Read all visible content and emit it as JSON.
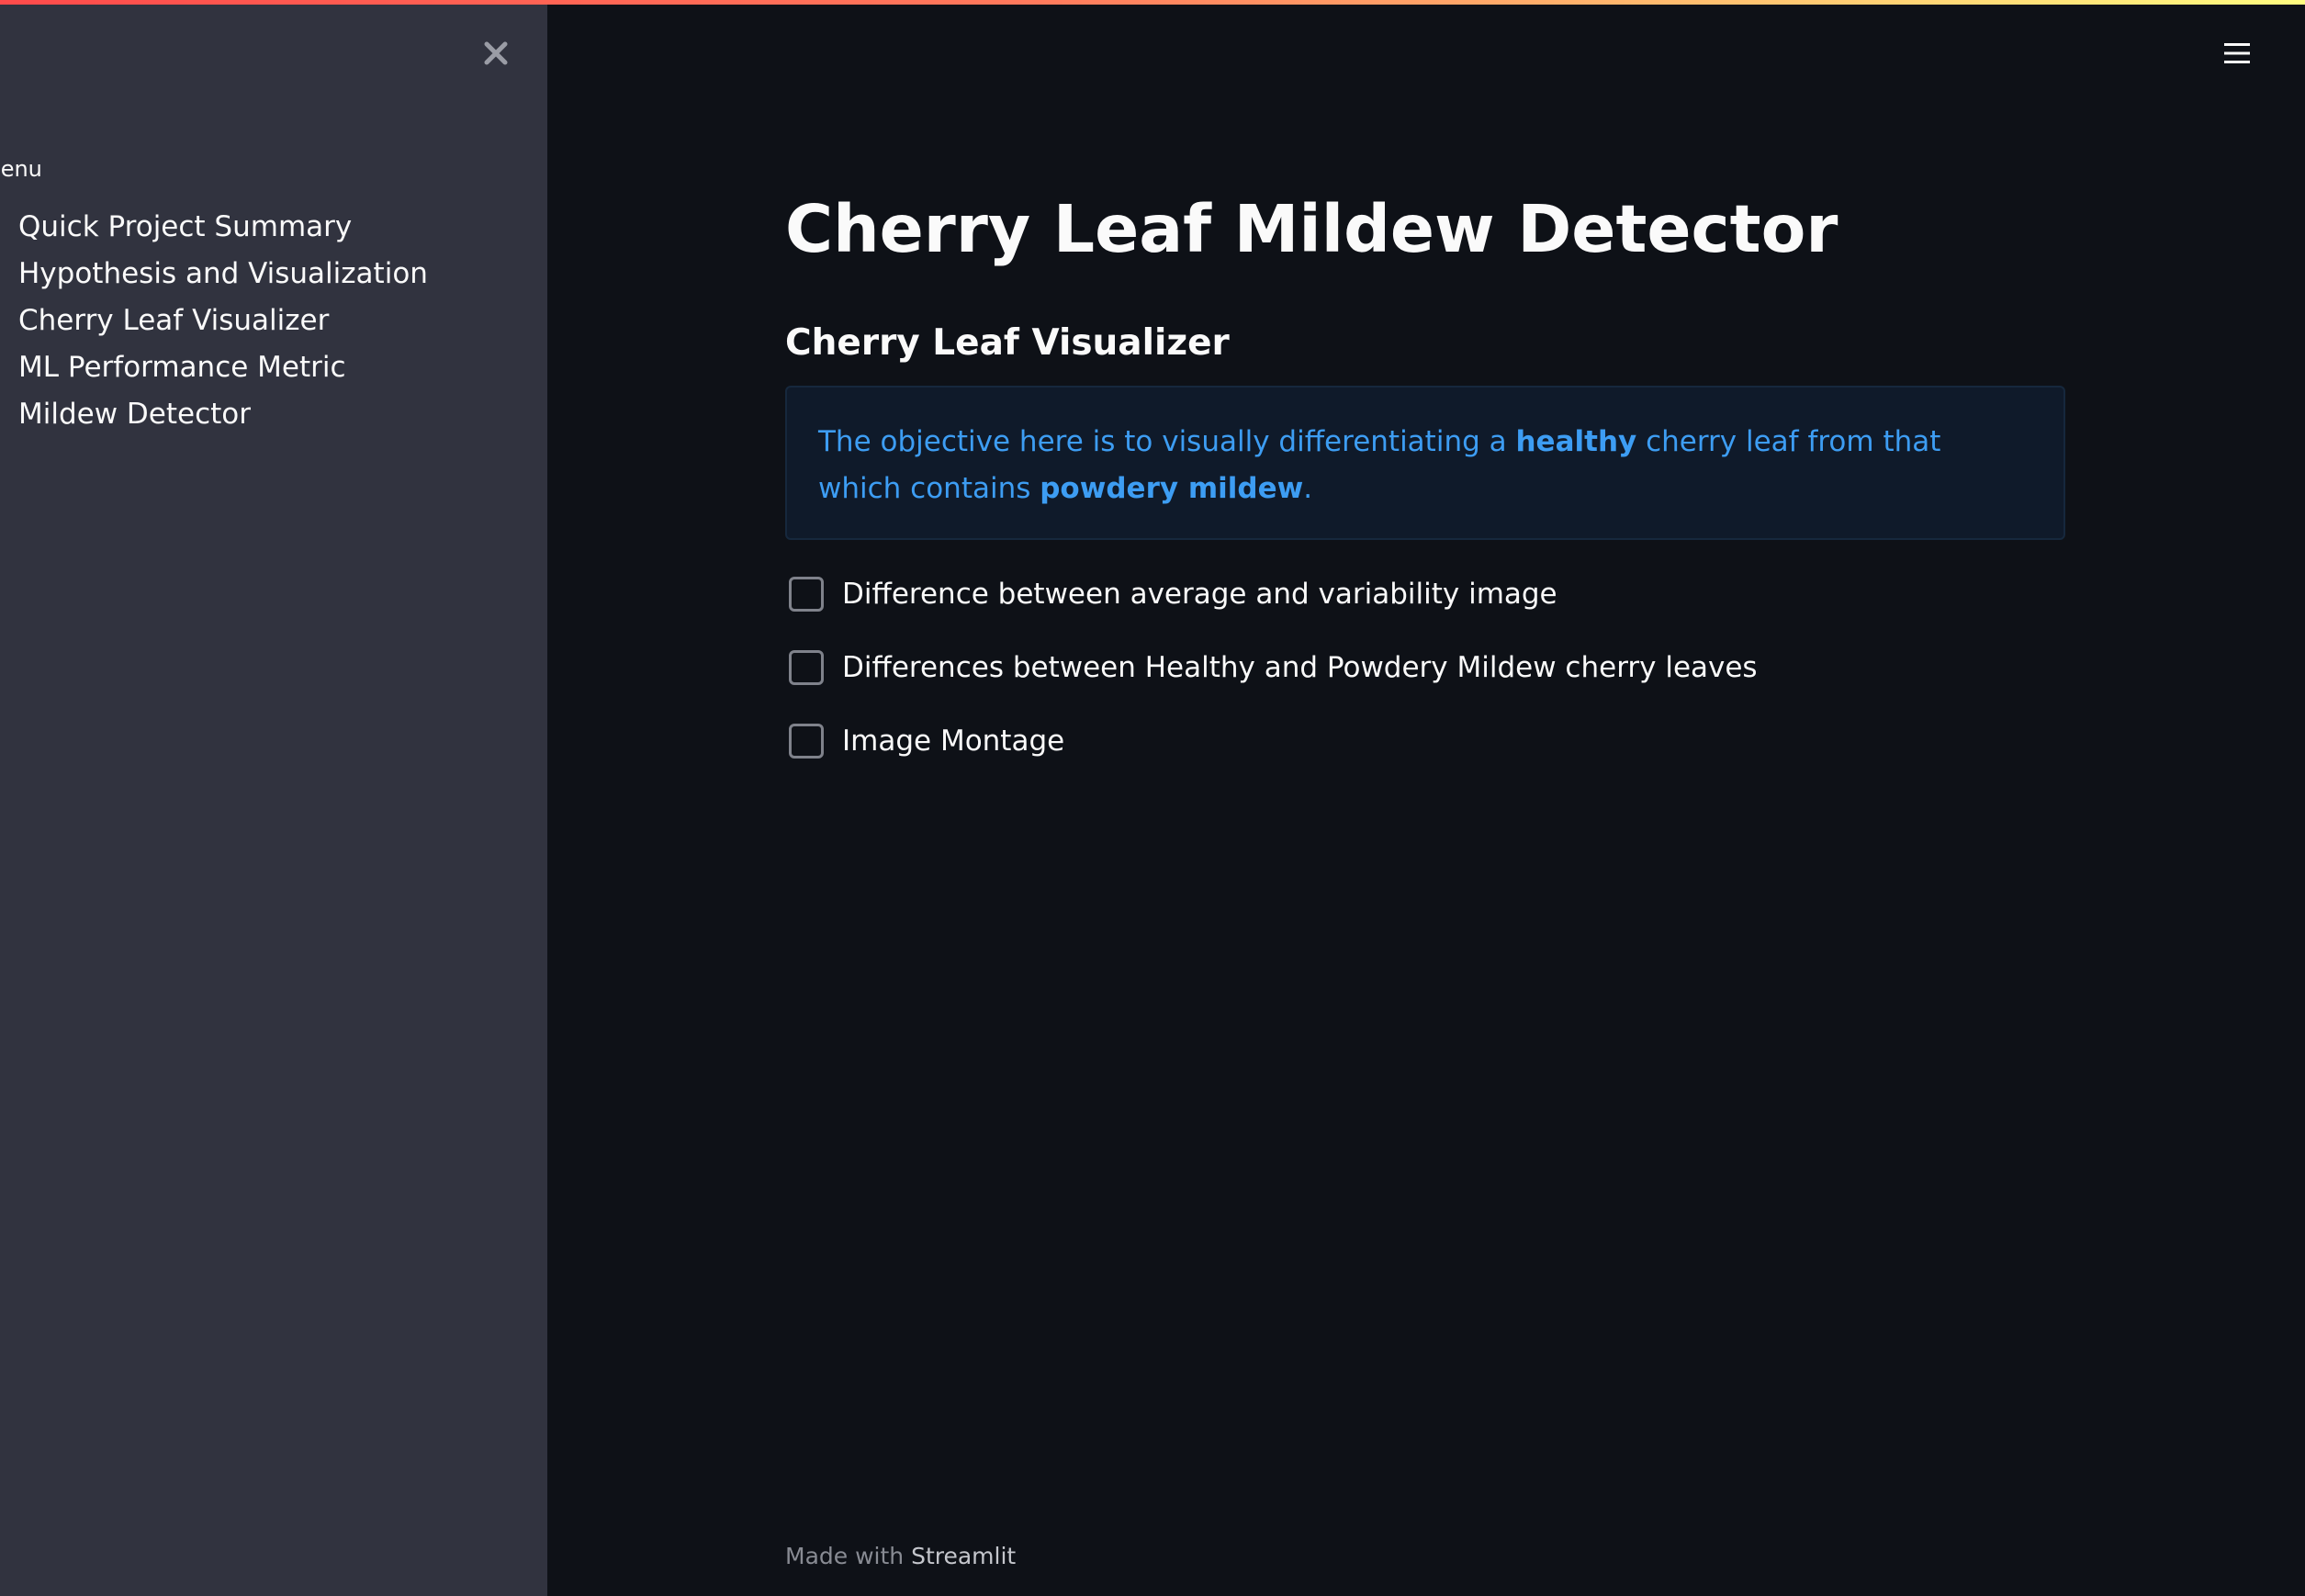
{
  "sidebar": {
    "menu_title": "Menu",
    "items": [
      {
        "label": "Quick Project Summary"
      },
      {
        "label": "Hypothesis and Visualization"
      },
      {
        "label": "Cherry Leaf Visualizer"
      },
      {
        "label": "ML Performance Metric"
      },
      {
        "label": "Mildew Detector"
      }
    ],
    "close_icon": "close-icon"
  },
  "header": {
    "menu_icon": "hamburger-menu-icon"
  },
  "main": {
    "title": "Cherry Leaf Mildew Detector",
    "subtitle": "Cherry Leaf Visualizer",
    "info": {
      "part1": "The objective here is to visually differentiating a ",
      "bold1": "healthy",
      "part2": " cherry leaf from that which contains ",
      "bold2": "powdery mildew",
      "part3": "."
    },
    "checkboxes": [
      {
        "label": "Difference between average and variability image",
        "checked": false
      },
      {
        "label": "Differences between Healthy and Powdery Mildew cherry leaves",
        "checked": false
      },
      {
        "label": "Image Montage",
        "checked": false
      }
    ]
  },
  "footer": {
    "prefix": "Made with ",
    "brand": "Streamlit"
  },
  "colors": {
    "background": "#0e1117",
    "sidebar_background": "#31333f",
    "info_text": "#3d9df3",
    "info_background": "#0f1a2a",
    "accent_gradient_start": "#ff4b4b",
    "accent_gradient_end": "#fffd80"
  }
}
